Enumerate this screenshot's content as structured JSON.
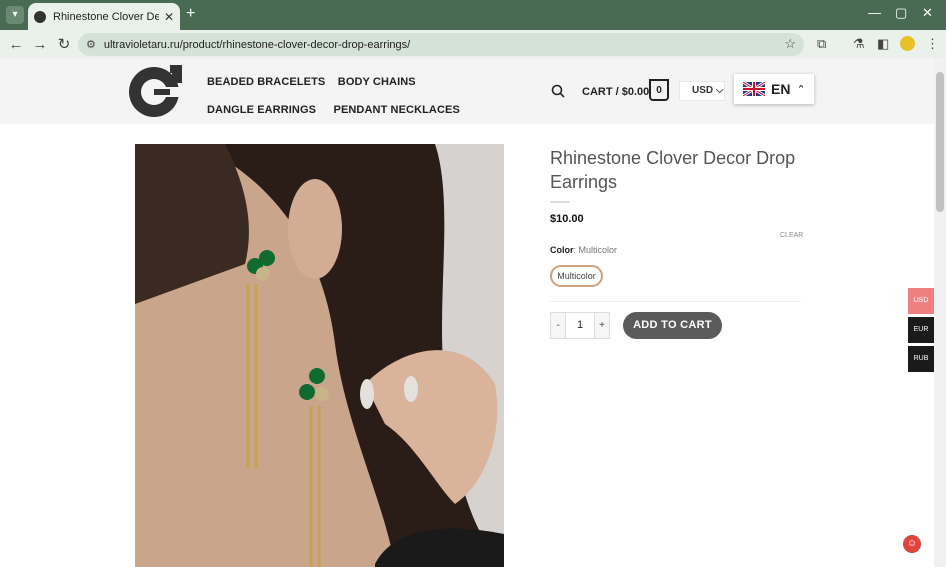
{
  "browser": {
    "tab_title": "Rhinestone Clover Decor Drop",
    "tab_close": "✕",
    "new_tab": "+",
    "url": "ultravioletaru.ru/product/rhinestone-clover-decor-drop-earrings/",
    "icons": [
      "tab-search-icon",
      "back-icon",
      "forward-icon",
      "reload-icon",
      "site-info-icon",
      "star-icon",
      "extensions-icon",
      "labs-icon",
      "sidebar-icon",
      "profile-icon",
      "menu-icon",
      "minimize-icon",
      "maximize-icon",
      "close-icon"
    ]
  },
  "header": {
    "nav": [
      "BEADED BRACELETS",
      "BODY CHAINS",
      "DANGLE EARRINGS",
      "PENDANT NECKLACES"
    ],
    "cart_label": "CART / $0.00",
    "cart_count": "0",
    "currency": "USD",
    "language": "EN"
  },
  "product": {
    "title": "Rhinestone Clover Decor Drop Earrings",
    "price": "$10.00",
    "clear": "CLEAR",
    "color_label": "Color",
    "color_value": "Multicolor",
    "option": "Multicolor",
    "qty_minus": "-",
    "quantity": "1",
    "qty_plus": "+",
    "add_to_cart": "ADD TO CART"
  },
  "currency_switcher": [
    {
      "label": "USD",
      "color": "#f08080"
    },
    {
      "label": "EUR",
      "color": "#1a1a1a"
    },
    {
      "label": "RUB",
      "color": "#1a1a1a"
    }
  ],
  "colors": {
    "chrome": "#4a6b53",
    "tab_active": "#eaf1eb",
    "add_to_cart": "#5b5b5b",
    "swatch_border": "#d2a07a"
  }
}
